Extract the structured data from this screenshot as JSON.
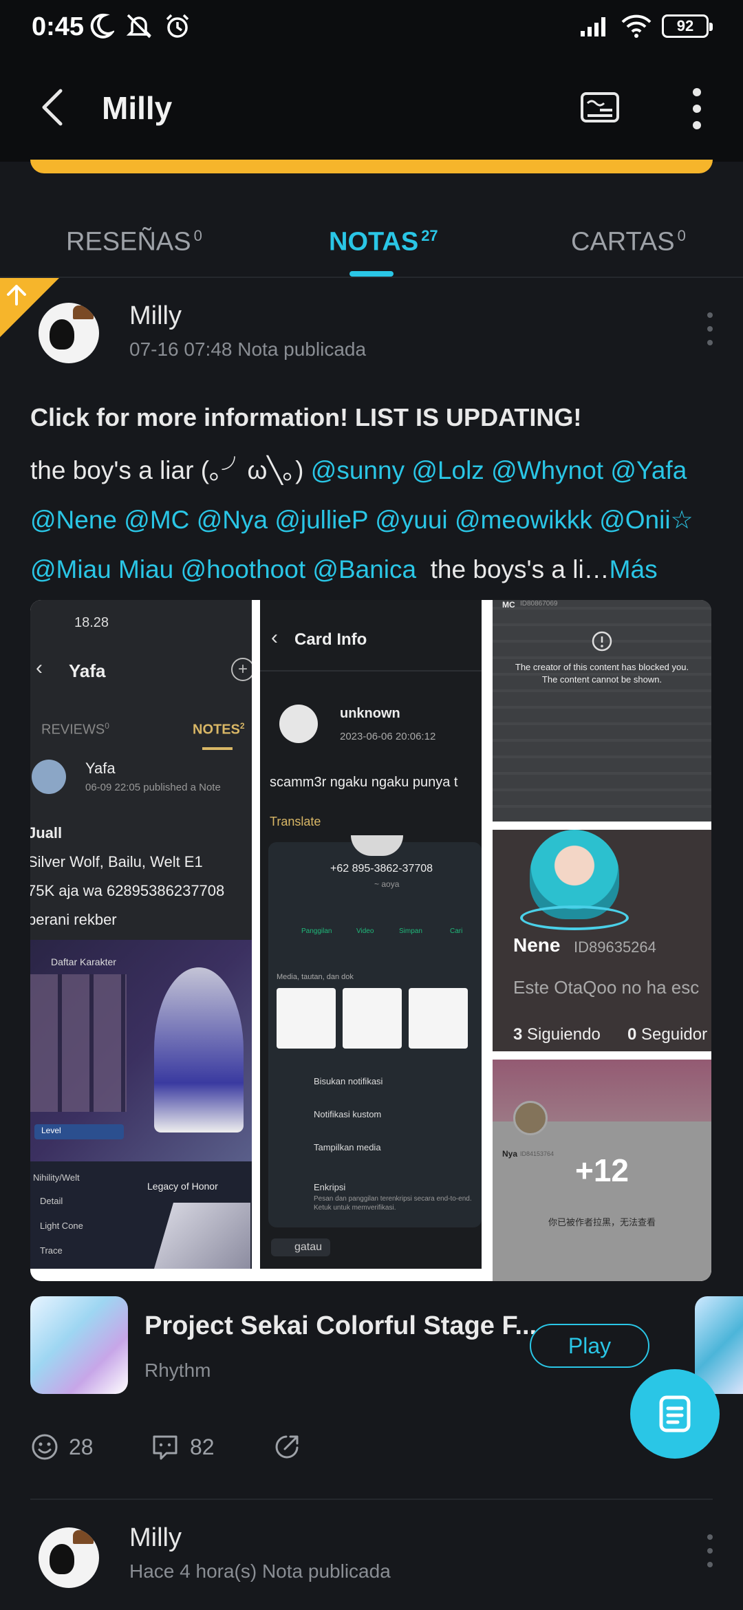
{
  "status_bar": {
    "time": "0:45",
    "battery": "92",
    "icons": [
      "moon-icon",
      "bell-off-icon",
      "alarm-icon",
      "signal-icon",
      "wifi-icon",
      "battery-icon"
    ]
  },
  "app_bar": {
    "title": "Milly",
    "icons": [
      "back-arrow-icon",
      "card-icon",
      "more-vertical-icon"
    ]
  },
  "tabs": [
    {
      "label": "RESEÑAS",
      "count": "0",
      "active": false
    },
    {
      "label": "NOTAS",
      "count": "27",
      "active": true
    },
    {
      "label": "CARTAS",
      "count": "0",
      "active": false
    }
  ],
  "colors": {
    "accent": "#2ac6e6",
    "pin": "#f6b52b",
    "background": "#16181c"
  },
  "posts": [
    {
      "author": "Milly",
      "meta": "07-16 07:48 Nota publicada",
      "pinned": true,
      "title": "Click for more information! LIST IS UPDATING!",
      "body_prefix": "the boy's a liar (｡╯ω╲｡) ",
      "mentions_line1": [
        "@sunny",
        "@Lolz",
        "@Whynot",
        "@Yafa"
      ],
      "mentions_line2": [
        "@Nene",
        "@MC",
        "@Nya",
        "@jullieP",
        "@yuui",
        "@meowikkk",
        "@Onii☆"
      ],
      "mentions_line3": [
        "@Miau Miau",
        "@hoothoot",
        "@Banica"
      ],
      "body_suffix": "  the boys's a li…",
      "more_label": "Más",
      "images": {
        "img1": {
          "time": "18.28",
          "name": "Yafa",
          "tab_reviews": "REVIEWS",
          "tab_reviews_count": "0",
          "tab_notes": "NOTES",
          "tab_notes_count": "2",
          "author": "Yafa",
          "meta": "06-09 22:05 published a Note",
          "lines": [
            "Juall",
            "Silver Wolf, Bailu, Welt E1",
            "75K aja wa 62895386237708",
            "berani rekber"
          ],
          "panel_title": "Daftar Karakter",
          "level_label": "Level",
          "menu_title": "Nihility/Welt",
          "menu_items": [
            "Detail",
            "Light Cone",
            "Trace"
          ],
          "legacy": "Legacy of Honor"
        },
        "img2": {
          "header": "Card Info",
          "author": "unknown",
          "date": "2023-06-06 20:06:12",
          "text": "scamm3r ngaku ngaku punya t",
          "translate": "Translate",
          "phone": "+62 895-3862-37708",
          "subname": "~ aoya",
          "actions": [
            "Panggilan",
            "Video",
            "Simpan",
            "Cari"
          ],
          "media_label": "Media, tautan, dan dok",
          "settings": [
            "Bisukan notifikasi",
            "Notifikasi kustom",
            "Tampilkan media",
            "Enkripsi"
          ],
          "encrypt_desc": "Pesan dan panggilan terenkripsi secara end-to-end. Ketuk untuk memverifikasi.",
          "chip": "gatau"
        },
        "img3": {
          "id": "MC",
          "id_num": "ID80867069",
          "blocked_line1": "The creator of this content has blocked you.",
          "blocked_line2": "The content cannot be shown."
        },
        "img4": {
          "name": "Nene",
          "id": "ID89635264",
          "text": "Este OtaQoo no ha esc",
          "following_count": "3",
          "following_label": "Siguiendo",
          "followers_count": "0",
          "followers_label": "Seguidor"
        },
        "img5": {
          "name": "Nya",
          "id": "ID84153764",
          "blocked": "你已被作者拉黑，无法查看",
          "more_count": "+12"
        }
      },
      "game": {
        "title": "Project Sekai Colorful Stage F...",
        "genre": "Rhythm",
        "button": "Play"
      },
      "reactions": "28",
      "comments": "82"
    },
    {
      "author": "Milly",
      "meta": "Hace 4 hora(s) Nota publicada"
    }
  ]
}
